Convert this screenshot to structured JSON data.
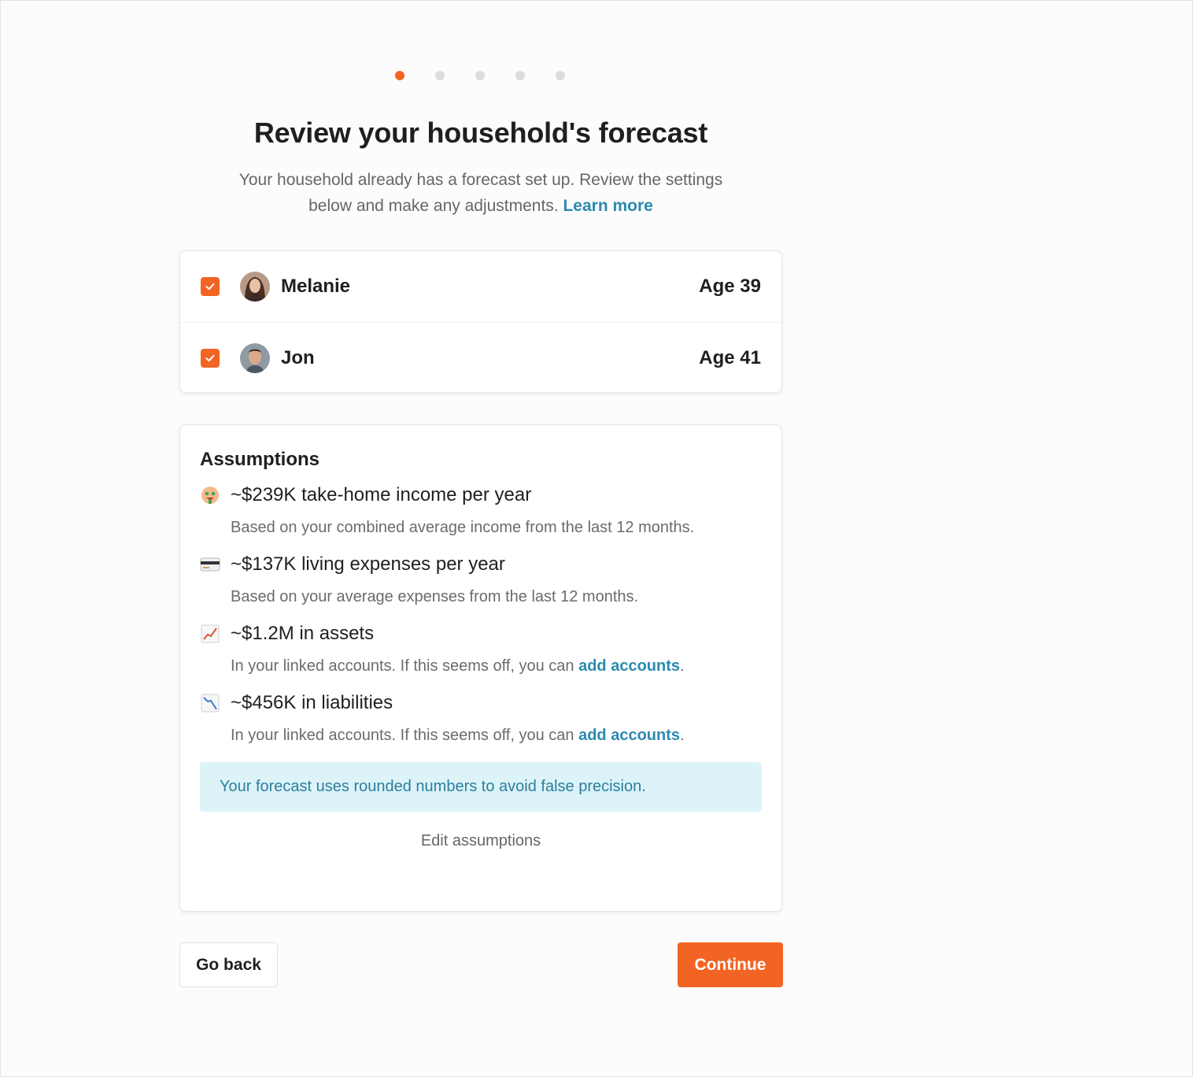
{
  "stepper": {
    "total": 5,
    "current": 1
  },
  "title": "Review your household's forecast",
  "subtitle": {
    "text": "Your household already has a forecast set up. Review the settings below and make any adjustments.",
    "link": "Learn more"
  },
  "household": {
    "members": [
      {
        "name": "Melanie",
        "age": "Age 39",
        "checked": true
      },
      {
        "name": "Jon",
        "age": "Age 41",
        "checked": true
      }
    ]
  },
  "assumptions": {
    "title": "Assumptions",
    "items": [
      {
        "icon": "money-face-icon",
        "label": "~$239K take-home income per year",
        "desc": "Based on your combined average income from the last 12 months.",
        "link": ""
      },
      {
        "icon": "credit-card-icon",
        "label": "~$137K living expenses per year",
        "desc": "Based on your average expenses from the last 12 months.",
        "link": ""
      },
      {
        "icon": "chart-up-icon",
        "label": "~$1.2M in assets",
        "desc": "In your linked accounts. If this seems off, you can",
        "link": "add accounts"
      },
      {
        "icon": "chart-down-icon",
        "label": "~$456K in liabilities",
        "desc": "In your linked accounts. If this seems off, you can",
        "link": "add accounts"
      }
    ],
    "notice": "Your forecast uses rounded numbers to avoid false precision.",
    "edit_label": "Edit assumptions"
  },
  "buttons": {
    "back": "Go back",
    "continue": "Continue"
  },
  "colors": {
    "accent": "#f26424",
    "link": "#2b8ab0",
    "notice_bg": "#dcf3f8"
  }
}
